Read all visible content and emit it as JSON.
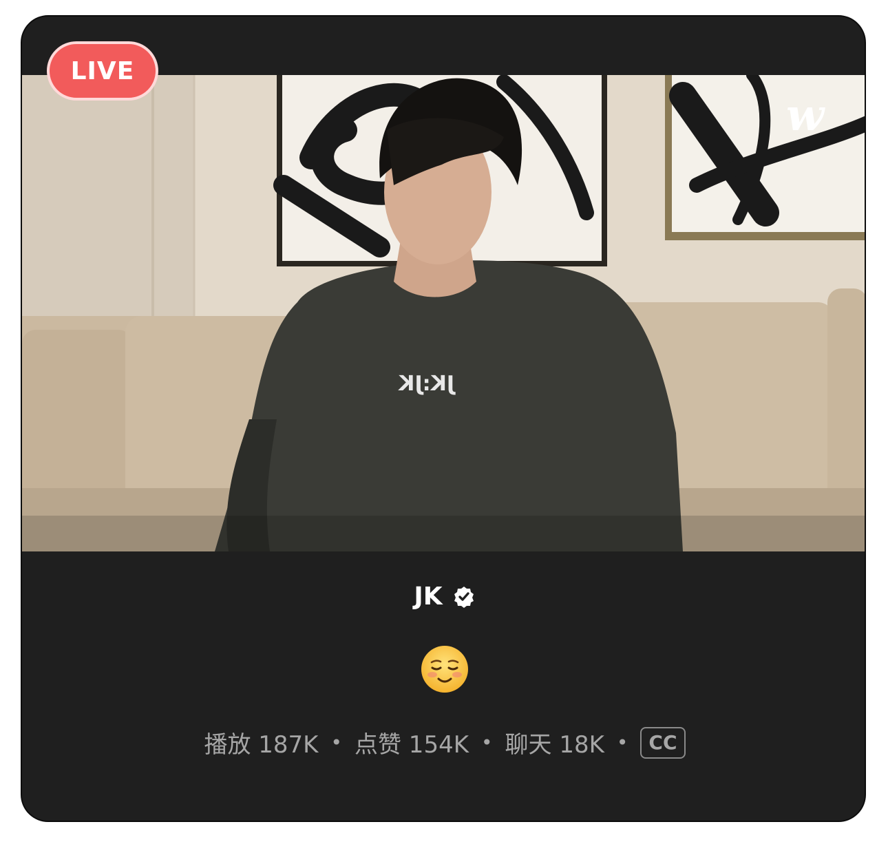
{
  "badge": {
    "live_label": "LIVE"
  },
  "video": {
    "watermark_icon": "weverse-logo-icon"
  },
  "creator": {
    "name": "JK",
    "verified_icon": "verified-badge-icon"
  },
  "caption": {
    "emoji_icon": "smiling-face-icon"
  },
  "stats": {
    "plays": "播放 187K",
    "likes": "点赞 154K",
    "chats": "聊天 18K",
    "separator": "•",
    "cc_label": "CC"
  },
  "colors": {
    "card_bg": "#1f1f1f",
    "live_red": "#f25b5b",
    "text_primary": "#ffffff",
    "text_secondary": "#a6a6a6"
  }
}
